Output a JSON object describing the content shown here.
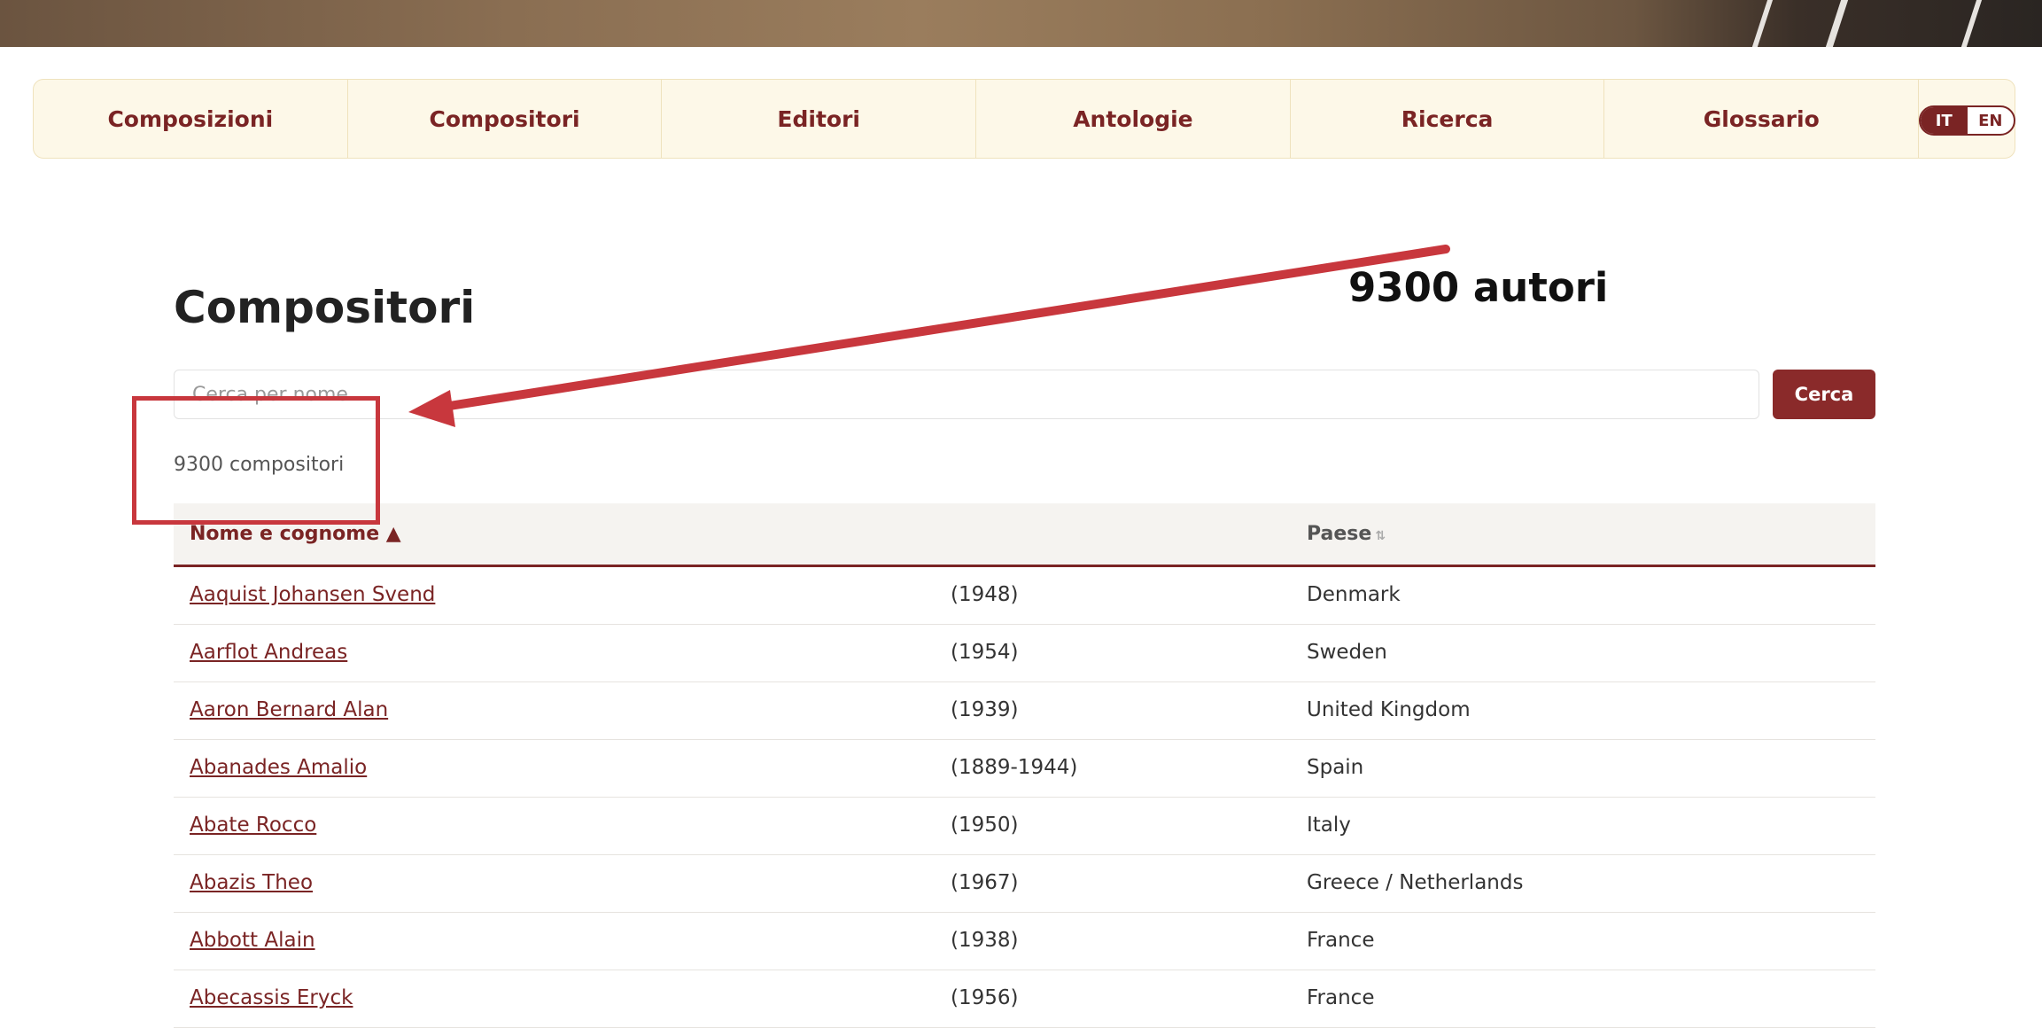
{
  "nav": {
    "items": [
      "Composizioni",
      "Compositori",
      "Editori",
      "Antologie",
      "Ricerca",
      "Glossario"
    ],
    "lang": {
      "active": "IT",
      "other": "EN"
    }
  },
  "page": {
    "title": "Compositori",
    "search": {
      "placeholder": "Cerca per nome...",
      "value": "",
      "button": "Cerca"
    },
    "count": "9300 compositori"
  },
  "table": {
    "headers": {
      "name": "Nome e cognome ▲",
      "years": "",
      "country": "Paese"
    },
    "country_sort_icon": "⇅",
    "rows": [
      {
        "name": "Aaquist Johansen Svend",
        "years": "(1948)",
        "country": "Denmark"
      },
      {
        "name": "Aarflot Andreas",
        "years": "(1954)",
        "country": "Sweden"
      },
      {
        "name": "Aaron Bernard Alan",
        "years": "(1939)",
        "country": "United Kingdom"
      },
      {
        "name": "Abanades Amalio",
        "years": "(1889-1944)",
        "country": "Spain"
      },
      {
        "name": "Abate Rocco",
        "years": "(1950)",
        "country": "Italy"
      },
      {
        "name": "Abazis Theo",
        "years": "(1967)",
        "country": "Greece / Netherlands"
      },
      {
        "name": "Abbott Alain",
        "years": "(1938)",
        "country": "France"
      },
      {
        "name": "Abecassis Eryck",
        "years": "(1956)",
        "country": "France"
      }
    ]
  },
  "annotation": {
    "text": "9300 autori",
    "color": "#c8373d"
  },
  "colors": {
    "accent": "#7a2424",
    "nav_bg": "#fdf8e8",
    "button": "#8a2a2a"
  }
}
